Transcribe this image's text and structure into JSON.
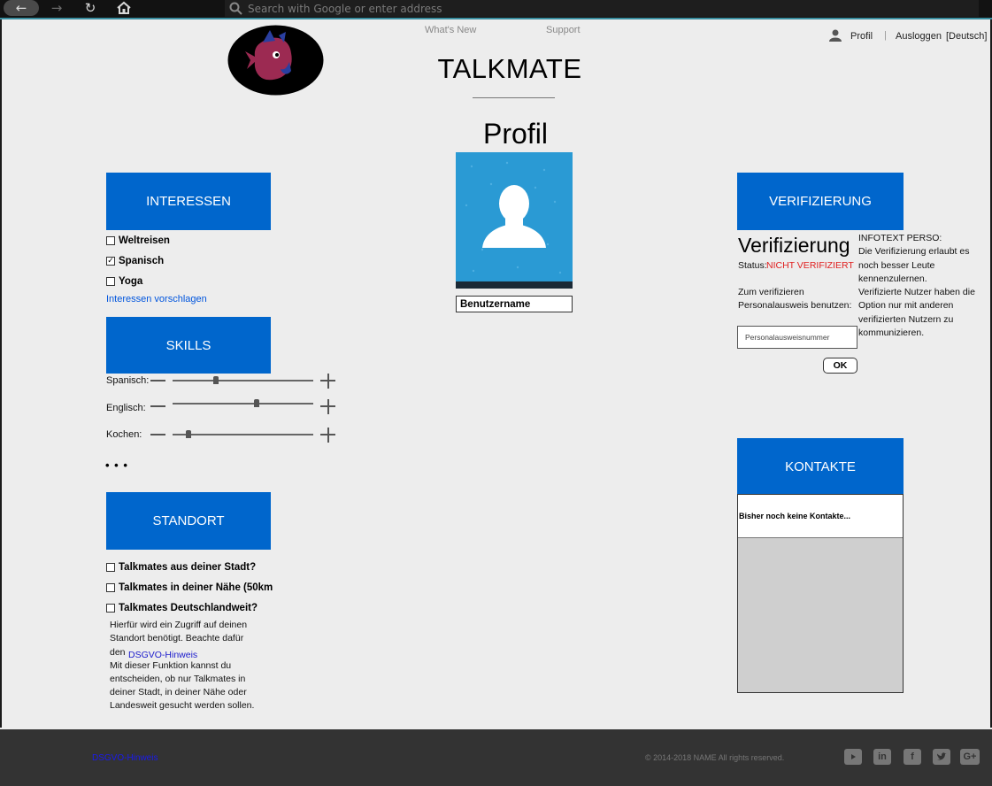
{
  "browser": {
    "address_placeholder": "Search with Google or enter address"
  },
  "header": {
    "whats_new": "What's New",
    "support": "Support",
    "profil": "Profil",
    "separator": "|",
    "logout": "Ausloggen",
    "language": "[Deutsch]",
    "title": "TALKMATE"
  },
  "profile": {
    "heading": "Profil",
    "username": "Benutzername"
  },
  "interests": {
    "button": "INTERESSEN",
    "items": [
      {
        "label": "Weltreisen",
        "checked": false
      },
      {
        "label": "Spanisch",
        "checked": true
      },
      {
        "label": "Yoga",
        "checked": false
      }
    ],
    "suggest_link": "Interessen vorschlagen"
  },
  "skills": {
    "button": "SKILLS",
    "items": [
      {
        "label": "Spanisch:",
        "level": 0.3
      },
      {
        "label": "Englisch:",
        "level": 0.6
      },
      {
        "label": "Kochen:",
        "level": 0.1
      }
    ],
    "more": "• • •"
  },
  "location": {
    "button": "STANDORT",
    "options": [
      {
        "label": "Talkmates aus deiner Stadt?",
        "checked": false
      },
      {
        "label": "Talkmates in deiner Nähe (50km",
        "checked": false
      },
      {
        "label": "Talkmates Deutschlandweit?",
        "checked": false
      }
    ],
    "info_1": "Hierfür wird ein Zugriff auf deinen",
    "info_2": "Standort benötigt. Beachte dafür",
    "info_3": "den",
    "info_link": "DSGVO-Hinweis",
    "info_4": "Mit dieser Funktion kannst du",
    "info_5": "entscheiden, ob nur Talkmates in",
    "info_6": "deiner Stadt, in deiner Nähe oder",
    "info_7": "Landesweit gesucht werden sollen."
  },
  "verification": {
    "button": "VERIFIZIERUNG",
    "title": "Verifizierung",
    "status_label": "Status:",
    "status_value": "NICHT VERIFIZIERT",
    "status_color": "#e02020",
    "instruction_1": "Zum verifizieren",
    "instruction_2": "Personalausweis benutzen:",
    "input_placeholder": "Personalausweisnummer",
    "ok": "OK",
    "info_1": "INFOTEXT PERSO:",
    "info_2": "Die Verifizierung erlaubt es",
    "info_3": "noch besser Leute",
    "info_4": "kennenzulernen.",
    "info_5": "Verifizierte Nutzer haben die",
    "info_6": "Option nur mit anderen",
    "info_7": "verifizierten Nutzern zu",
    "info_8": "kommunizieren."
  },
  "contacts": {
    "button": "KONTAKTE",
    "empty": "Bisher noch keine Kontakte..."
  },
  "footer": {
    "link": "DSGVO-Hinweis",
    "copyright": "© 2014-2018 NAME All rights reserved.",
    "social_icons": [
      "youtube-icon",
      "linkedin-icon",
      "facebook-icon",
      "twitter-icon",
      "google-plus-icon"
    ]
  },
  "colors": {
    "accent": "#0066cc",
    "footer_bg": "#333333",
    "page_bg": "#ededed"
  }
}
